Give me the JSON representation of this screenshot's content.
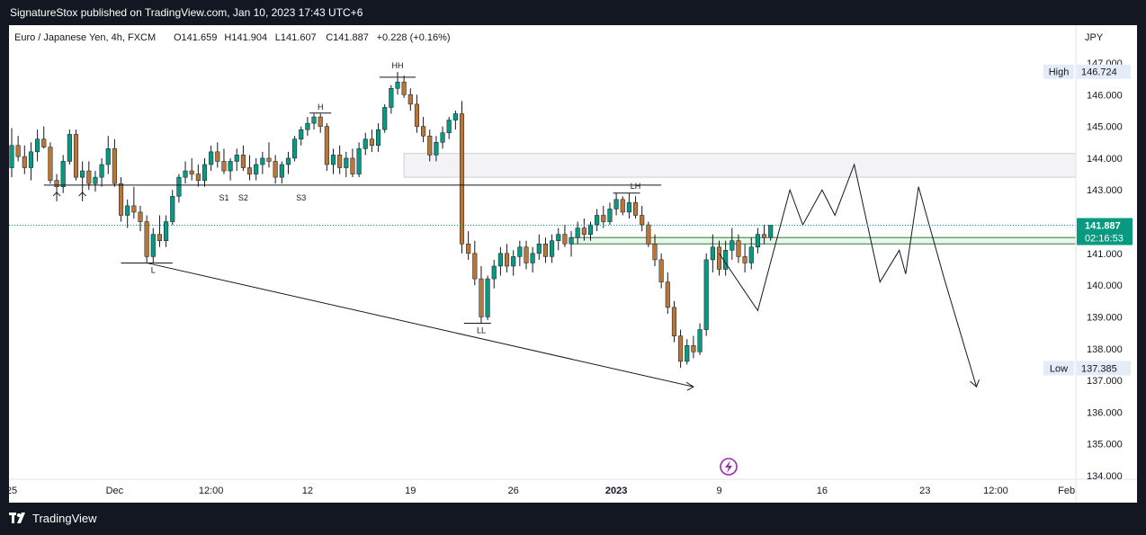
{
  "header": {
    "published_line": "SignatureStox published on TradingView.com, Jan 10, 2023 17:43 UTC+6"
  },
  "footer": {
    "brand": "TradingView",
    "logo_mark": "17"
  },
  "colors": {
    "background_outer": "#131722",
    "candle_up": "#089981",
    "candle_down": "#b7773a",
    "current_price_bg": "#089981",
    "zone_green": "#2e7d32",
    "event_icon": "#9c27b0"
  },
  "chart_data": {
    "type": "candlestick",
    "symbol_line": {
      "name": "Euro / Japanese Yen, 4h, FXCM",
      "open": "O141.659",
      "high": "H141.904",
      "low": "L141.607",
      "close": "C141.887",
      "change": "+0.228 (+0.16%)"
    },
    "currency": "JPY",
    "ylim": [
      134.0,
      147.0
    ],
    "y_ticks": [
      "134.000",
      "135.000",
      "136.000",
      "137.000",
      "138.000",
      "139.000",
      "140.000",
      "141.000",
      "142.000",
      "143.000",
      "144.000",
      "145.000",
      "146.000",
      "147.000"
    ],
    "x_ticks": [
      {
        "label": "25",
        "t": 0
      },
      {
        "label": "Dec",
        "t": 16
      },
      {
        "label": "12:00",
        "t": 31
      },
      {
        "label": "12",
        "t": 46
      },
      {
        "label": "19",
        "t": 62
      },
      {
        "label": "26",
        "t": 78
      },
      {
        "label": "2023",
        "t": 94
      },
      {
        "label": "9",
        "t": 110
      },
      {
        "label": "16",
        "t": 126
      },
      {
        "label": "23",
        "t": 142
      },
      {
        "label": "12:00",
        "t": 153
      },
      {
        "label": "Feb",
        "t": 164
      }
    ],
    "price_markers": {
      "high_label": "High",
      "high_value": "146.724",
      "high": 146.724,
      "low_label": "Low",
      "low_value": "137.385",
      "low": 137.385,
      "current_value": "141.887",
      "current": 141.887,
      "countdown": "02:16:53"
    },
    "candles": [
      [
        143.7,
        144.95,
        143.4,
        144.4
      ],
      [
        144.4,
        144.7,
        143.9,
        144.05
      ],
      [
        144.05,
        144.4,
        143.5,
        143.7
      ],
      [
        143.7,
        144.5,
        143.3,
        144.2
      ],
      [
        144.2,
        144.9,
        143.9,
        144.6
      ],
      [
        144.6,
        145.0,
        144.3,
        144.35
      ],
      [
        144.35,
        144.5,
        143.2,
        143.3
      ],
      [
        143.3,
        143.5,
        142.9,
        143.1
      ],
      [
        143.1,
        144.1,
        142.9,
        143.9
      ],
      [
        143.9,
        144.9,
        143.8,
        144.75
      ],
      [
        144.75,
        144.9,
        143.3,
        143.4
      ],
      [
        143.4,
        143.9,
        142.9,
        143.6
      ],
      [
        143.6,
        143.9,
        143.0,
        143.2
      ],
      [
        143.2,
        143.6,
        142.95,
        143.4
      ],
      [
        143.4,
        144.0,
        143.1,
        143.8
      ],
      [
        143.8,
        144.7,
        143.5,
        144.3
      ],
      [
        144.3,
        144.6,
        143.1,
        143.2
      ],
      [
        143.2,
        143.4,
        142.0,
        142.2
      ],
      [
        142.2,
        142.7,
        141.8,
        142.5
      ],
      [
        142.5,
        143.1,
        142.1,
        142.3
      ],
      [
        142.3,
        142.5,
        141.7,
        142.0
      ],
      [
        142.0,
        142.2,
        140.7,
        140.9
      ],
      [
        140.9,
        141.8,
        140.7,
        141.6
      ],
      [
        141.6,
        142.2,
        141.2,
        141.4
      ],
      [
        141.4,
        142.2,
        141.2,
        142.0
      ],
      [
        142.0,
        143.0,
        141.9,
        142.8
      ],
      [
        142.8,
        143.5,
        142.6,
        143.4
      ],
      [
        143.4,
        143.9,
        143.2,
        143.6
      ],
      [
        143.6,
        144.0,
        143.3,
        143.5
      ],
      [
        143.5,
        143.8,
        143.1,
        143.3
      ],
      [
        143.3,
        144.0,
        143.1,
        143.8
      ],
      [
        143.8,
        144.4,
        143.6,
        144.2
      ],
      [
        144.2,
        144.5,
        143.7,
        143.9
      ],
      [
        143.9,
        144.3,
        143.5,
        143.6
      ],
      [
        143.6,
        144.0,
        143.3,
        143.9
      ],
      [
        143.9,
        144.3,
        143.6,
        144.1
      ],
      [
        144.1,
        144.4,
        143.6,
        143.7
      ],
      [
        143.7,
        144.1,
        143.3,
        143.5
      ],
      [
        143.5,
        144.0,
        143.3,
        143.8
      ],
      [
        143.8,
        144.2,
        143.5,
        144.0
      ],
      [
        144.0,
        144.5,
        143.7,
        143.9
      ],
      [
        143.9,
        144.1,
        143.2,
        143.4
      ],
      [
        143.4,
        143.9,
        143.2,
        143.8
      ],
      [
        143.8,
        144.2,
        143.5,
        144.0
      ],
      [
        144.0,
        144.7,
        143.9,
        144.6
      ],
      [
        144.6,
        145.0,
        144.4,
        144.9
      ],
      [
        144.9,
        145.3,
        144.7,
        145.1
      ],
      [
        145.1,
        145.4,
        144.9,
        145.3
      ],
      [
        145.3,
        145.4,
        144.8,
        145.0
      ],
      [
        145.0,
        145.1,
        143.6,
        143.8
      ],
      [
        143.8,
        144.3,
        143.5,
        144.1
      ],
      [
        144.1,
        144.4,
        143.5,
        143.7
      ],
      [
        143.7,
        144.2,
        143.4,
        144.0
      ],
      [
        144.0,
        144.3,
        143.4,
        143.5
      ],
      [
        143.5,
        144.5,
        143.4,
        144.3
      ],
      [
        144.3,
        144.8,
        144.1,
        144.6
      ],
      [
        144.6,
        144.9,
        144.2,
        144.4
      ],
      [
        144.4,
        145.1,
        144.2,
        144.9
      ],
      [
        144.9,
        145.7,
        144.8,
        145.6
      ],
      [
        145.6,
        146.3,
        145.4,
        146.2
      ],
      [
        146.2,
        146.72,
        146.0,
        146.4
      ],
      [
        146.4,
        146.6,
        145.9,
        146.0
      ],
      [
        146.0,
        146.2,
        145.5,
        145.7
      ],
      [
        145.7,
        146.0,
        144.8,
        145.0
      ],
      [
        145.0,
        145.3,
        144.5,
        144.7
      ],
      [
        144.7,
        144.9,
        143.9,
        144.1
      ],
      [
        144.1,
        144.7,
        143.9,
        144.5
      ],
      [
        144.5,
        145.0,
        144.3,
        144.8
      ],
      [
        144.8,
        145.3,
        144.6,
        145.2
      ],
      [
        145.2,
        145.5,
        144.9,
        145.4
      ],
      [
        145.4,
        145.8,
        141.0,
        141.3
      ],
      [
        141.3,
        141.7,
        140.8,
        141.0
      ],
      [
        141.0,
        141.4,
        140.0,
        140.2
      ],
      [
        140.2,
        140.6,
        138.8,
        139.0
      ],
      [
        139.0,
        140.3,
        138.9,
        140.2
      ],
      [
        140.2,
        140.8,
        139.9,
        140.6
      ],
      [
        140.6,
        141.2,
        140.3,
        141.0
      ],
      [
        141.0,
        141.3,
        140.4,
        140.6
      ],
      [
        140.6,
        141.1,
        140.3,
        140.9
      ],
      [
        140.9,
        141.4,
        140.6,
        141.2
      ],
      [
        141.2,
        141.4,
        140.5,
        140.7
      ],
      [
        140.7,
        141.2,
        140.4,
        141.0
      ],
      [
        141.0,
        141.6,
        140.8,
        141.3
      ],
      [
        141.3,
        141.5,
        140.7,
        140.9
      ],
      [
        140.9,
        141.6,
        140.7,
        141.4
      ],
      [
        141.4,
        141.8,
        141.1,
        141.6
      ],
      [
        141.6,
        141.9,
        141.2,
        141.3
      ],
      [
        141.3,
        141.7,
        140.9,
        141.5
      ],
      [
        141.5,
        142.0,
        141.3,
        141.8
      ],
      [
        141.8,
        142.1,
        141.4,
        141.6
      ],
      [
        141.6,
        142.0,
        141.4,
        141.9
      ],
      [
        141.9,
        142.4,
        141.7,
        142.2
      ],
      [
        142.2,
        142.5,
        141.8,
        142.0
      ],
      [
        142.0,
        142.6,
        141.9,
        142.4
      ],
      [
        142.4,
        142.9,
        142.2,
        142.7
      ],
      [
        142.7,
        142.8,
        142.2,
        142.3
      ],
      [
        142.3,
        142.9,
        142.1,
        142.6
      ],
      [
        142.6,
        142.8,
        142.1,
        142.2
      ],
      [
        142.2,
        142.5,
        141.7,
        141.9
      ],
      [
        141.9,
        142.0,
        141.2,
        141.3
      ],
      [
        141.3,
        141.6,
        140.6,
        140.8
      ],
      [
        140.8,
        141.0,
        139.9,
        140.1
      ],
      [
        140.1,
        140.4,
        139.1,
        139.3
      ],
      [
        139.3,
        139.5,
        138.2,
        138.4
      ],
      [
        138.4,
        138.6,
        137.4,
        137.6
      ],
      [
        137.6,
        138.3,
        137.5,
        138.1
      ],
      [
        138.1,
        138.4,
        137.7,
        137.9
      ],
      [
        137.9,
        138.8,
        137.8,
        138.6
      ],
      [
        138.6,
        141.0,
        138.4,
        140.8
      ],
      [
        140.8,
        141.6,
        140.4,
        141.2
      ],
      [
        141.2,
        141.4,
        140.3,
        140.5
      ],
      [
        140.5,
        141.4,
        140.3,
        141.1
      ],
      [
        141.1,
        141.8,
        140.8,
        141.4
      ],
      [
        141.4,
        141.6,
        140.7,
        140.9
      ],
      [
        140.9,
        141.3,
        140.4,
        140.7
      ],
      [
        140.7,
        141.5,
        140.5,
        141.2
      ],
      [
        141.2,
        141.8,
        141.0,
        141.6
      ],
      [
        141.6,
        141.9,
        141.3,
        141.5
      ],
      [
        141.5,
        141.9,
        141.4,
        141.89
      ]
    ],
    "annotations": [
      {
        "text": "HH",
        "t": 60,
        "price": 146.72
      },
      {
        "text": "H",
        "t": 48,
        "price": 145.42
      },
      {
        "text": "LH",
        "t": 97,
        "price": 142.92
      },
      {
        "text": "L",
        "t": 22,
        "price": 140.7
      },
      {
        "text": "LL",
        "t": 73,
        "price": 138.8
      },
      {
        "text": "S1",
        "t": 33,
        "price": 143.0
      },
      {
        "text": "S2",
        "t": 36,
        "price": 143.0
      },
      {
        "text": "S3",
        "t": 45,
        "price": 143.0
      }
    ],
    "projection_path": [
      [
        110,
        141.0
      ],
      [
        116,
        139.2
      ],
      [
        121,
        143.0
      ],
      [
        123,
        141.9
      ],
      [
        126,
        143.0
      ],
      [
        128,
        142.2
      ],
      [
        131,
        143.8
      ],
      [
        135,
        140.1
      ],
      [
        138,
        141.1
      ],
      [
        139,
        140.35
      ],
      [
        141,
        143.1
      ],
      [
        145,
        140.2
      ],
      [
        150,
        136.8
      ]
    ]
  }
}
